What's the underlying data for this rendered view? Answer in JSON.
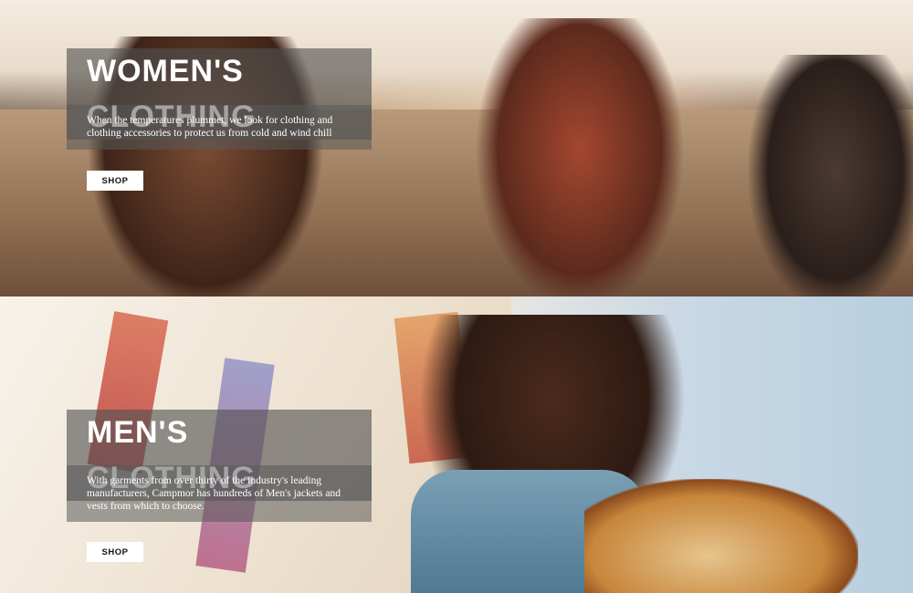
{
  "banners": [
    {
      "title": "WOMEN'S CLOTHING",
      "description": "When the temperatures plummet, we look for clothing and clothing accessories to protect us from cold and wind chill",
      "button_label": "SHOP"
    },
    {
      "title": "MEN'S CLOTHING",
      "description": "With garments from over thirty of the industry's leading manufacturers, Campmor has hundreds of Men's jackets and vests from which to choose.",
      "button_label": "SHOP"
    }
  ]
}
